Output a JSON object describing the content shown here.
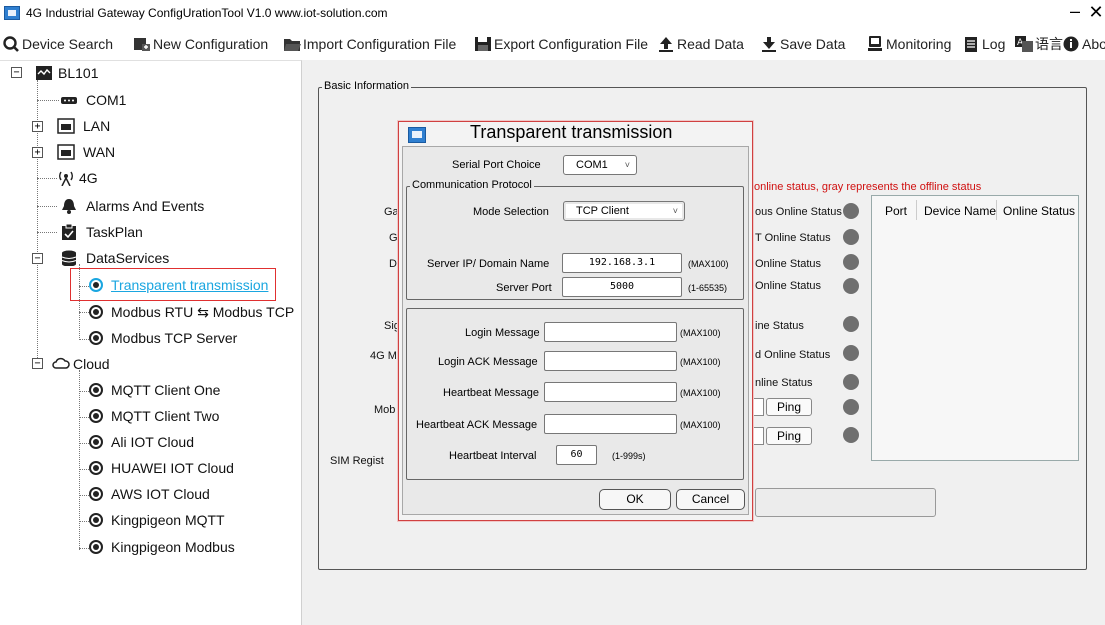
{
  "window": {
    "title": "4G Industrial Gateway ConfigUrationTool V1.0 www.iot-solution.com",
    "minimize": "–",
    "close": "✕"
  },
  "toolbar": {
    "device_search": "Device Search",
    "new_configuration": "New Configuration",
    "import_configuration": "Import Configuration File",
    "export_configuration": "Export Configuration File",
    "read_data": "Read Data",
    "save_data": "Save Data",
    "monitoring": "Monitoring",
    "log": "Log",
    "language": "语言",
    "about": "About"
  },
  "tree": {
    "root": "BL101",
    "com1": "COM1",
    "lan": "LAN",
    "wan": "WAN",
    "g4": "4G",
    "alarms": "Alarms And Events",
    "taskplan": "TaskPlan",
    "dataservices": "DataServices",
    "transparent": "Transparent transmission",
    "modbus_rtu_tcp": "Modbus RTU ⇆ Modbus TCP",
    "modbus_tcp_server": "Modbus TCP Server",
    "cloud": "Cloud",
    "mqtt_one": "MQTT Client One",
    "mqtt_two": "MQTT Client Two",
    "ali": "Ali IOT Cloud",
    "huawei": "HUAWEI IOT Cloud",
    "aws": "AWS IOT Cloud",
    "kp_mqtt": "Kingpigeon MQTT",
    "kp_modbus": "Kingpigeon Modbus"
  },
  "basic": {
    "legend": "Basic Information",
    "hint": "online status, gray represents the offline status",
    "labels": [
      "Ga",
      "G",
      "D",
      "Sig",
      "4G M",
      "Mob",
      "SIM Regist"
    ],
    "statuses": [
      "ous Online Status",
      "T Online Status",
      "Online Status",
      "Online Status",
      "ine Status",
      "d Online Status",
      "nline Status"
    ],
    "ping": "Ping",
    "table_headers": [
      "Port",
      "Device Name",
      "Online Status"
    ],
    "status_color": "#6f6f6f"
  },
  "modal": {
    "title": "Transparent transmission",
    "serial_port_label": "Serial Port Choice",
    "serial_port_value": "COM1",
    "protocol_legend": "Communication Protocol",
    "mode_label": "Mode Selection",
    "mode_value": "TCP Client",
    "server_ip_label": "Server IP/ Domain Name",
    "server_ip_value": "192.168.3.1",
    "server_ip_hint": "(MAX100)",
    "server_port_label": "Server Port",
    "server_port_value": "5000",
    "server_port_hint": "(1-65535)",
    "login_msg_label": "Login Message",
    "login_msg_value": "",
    "login_msg_hint": "(MAX100)",
    "login_ack_label": "Login ACK Message",
    "login_ack_value": "",
    "login_ack_hint": "(MAX100)",
    "heartbeat_label": "Heartbeat Message",
    "heartbeat_value": "",
    "heartbeat_hint": "(MAX100)",
    "heartbeat_ack_label": "Heartbeat ACK Message",
    "heartbeat_ack_value": "",
    "heartbeat_ack_hint": "(MAX100)",
    "interval_label": "Heartbeat Interval",
    "interval_value": "60",
    "interval_hint": "(1-999s)",
    "ok": "OK",
    "cancel": "Cancel"
  }
}
